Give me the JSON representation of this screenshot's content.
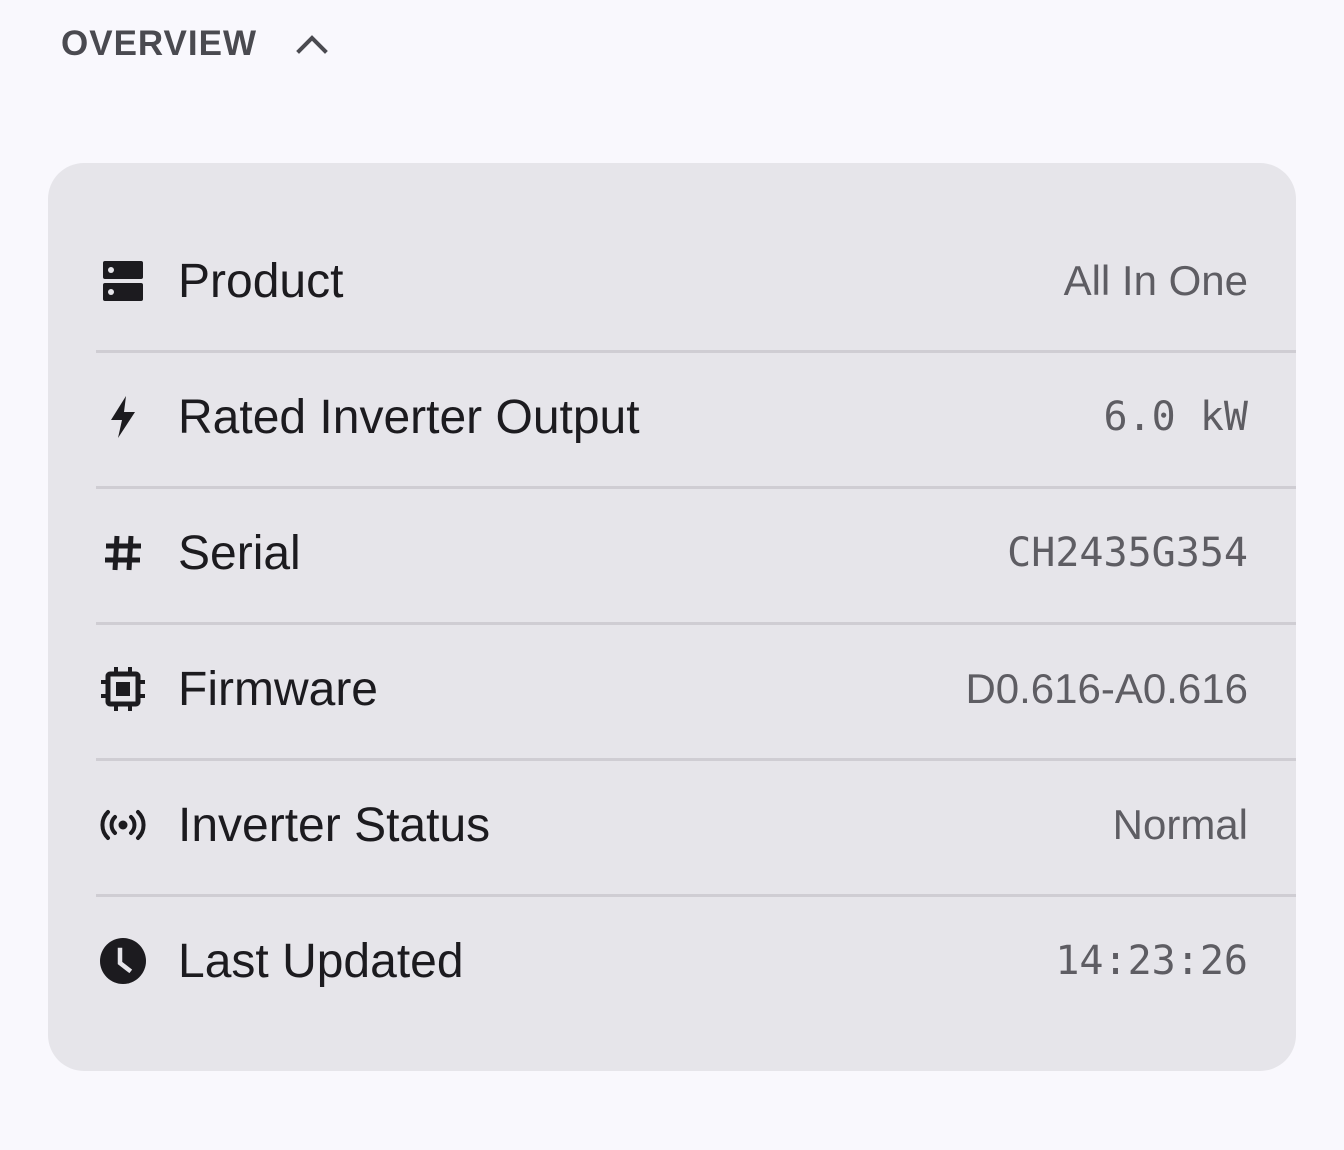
{
  "section": {
    "title": "OVERVIEW",
    "toggle_icon": "chevron-up-icon"
  },
  "rows": [
    {
      "icon": "server-icon",
      "label": "Product",
      "value": "All In One"
    },
    {
      "icon": "bolt-icon",
      "label": "Rated Inverter Output",
      "value": "6.0 kW"
    },
    {
      "icon": "hash-icon",
      "label": "Serial",
      "value": "CH2435G354"
    },
    {
      "icon": "chip-icon",
      "label": "Firmware",
      "value": "D0.616-A0.616"
    },
    {
      "icon": "broadcast-icon",
      "label": "Inverter Status",
      "value": "Normal"
    },
    {
      "icon": "clock-icon",
      "label": "Last Updated",
      "value": "14:23:26"
    }
  ],
  "colors": {
    "background": "#f9f8fd",
    "card": "#e6e5ea",
    "label": "#1c1b1f",
    "value": "#5e5d63",
    "header": "#4a4a50"
  }
}
